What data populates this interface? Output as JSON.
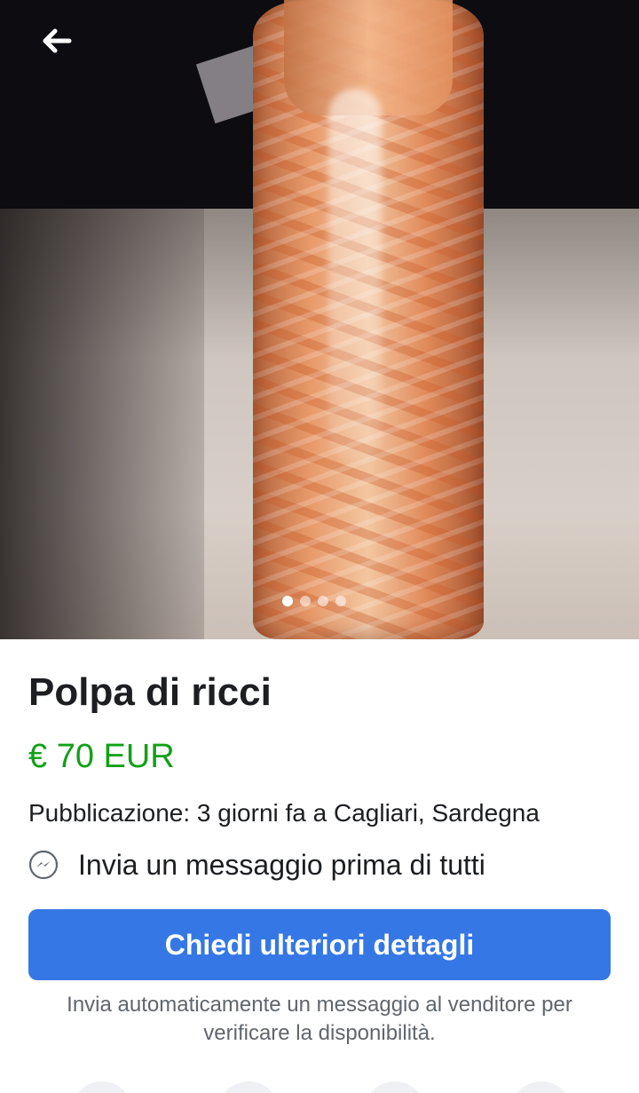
{
  "nav": {
    "back_icon": "arrow-left-icon"
  },
  "gallery": {
    "image_count": 4,
    "active_index": 0
  },
  "listing": {
    "title": "Polpa di ricci",
    "price": "€ 70 EUR",
    "posted": "Pubblicazione: 3 giorni fa a Cagliari, Sardegna",
    "message_prompt": "Invia un messaggio prima di tutti",
    "message_icon": "messenger-icon"
  },
  "cta": {
    "label": "Chiedi ulteriori dettagli",
    "note": "Invia automaticamente un messaggio al venditore per verificare la disponibilità."
  },
  "colors": {
    "price": "#13a018",
    "button": "#3578e5"
  }
}
